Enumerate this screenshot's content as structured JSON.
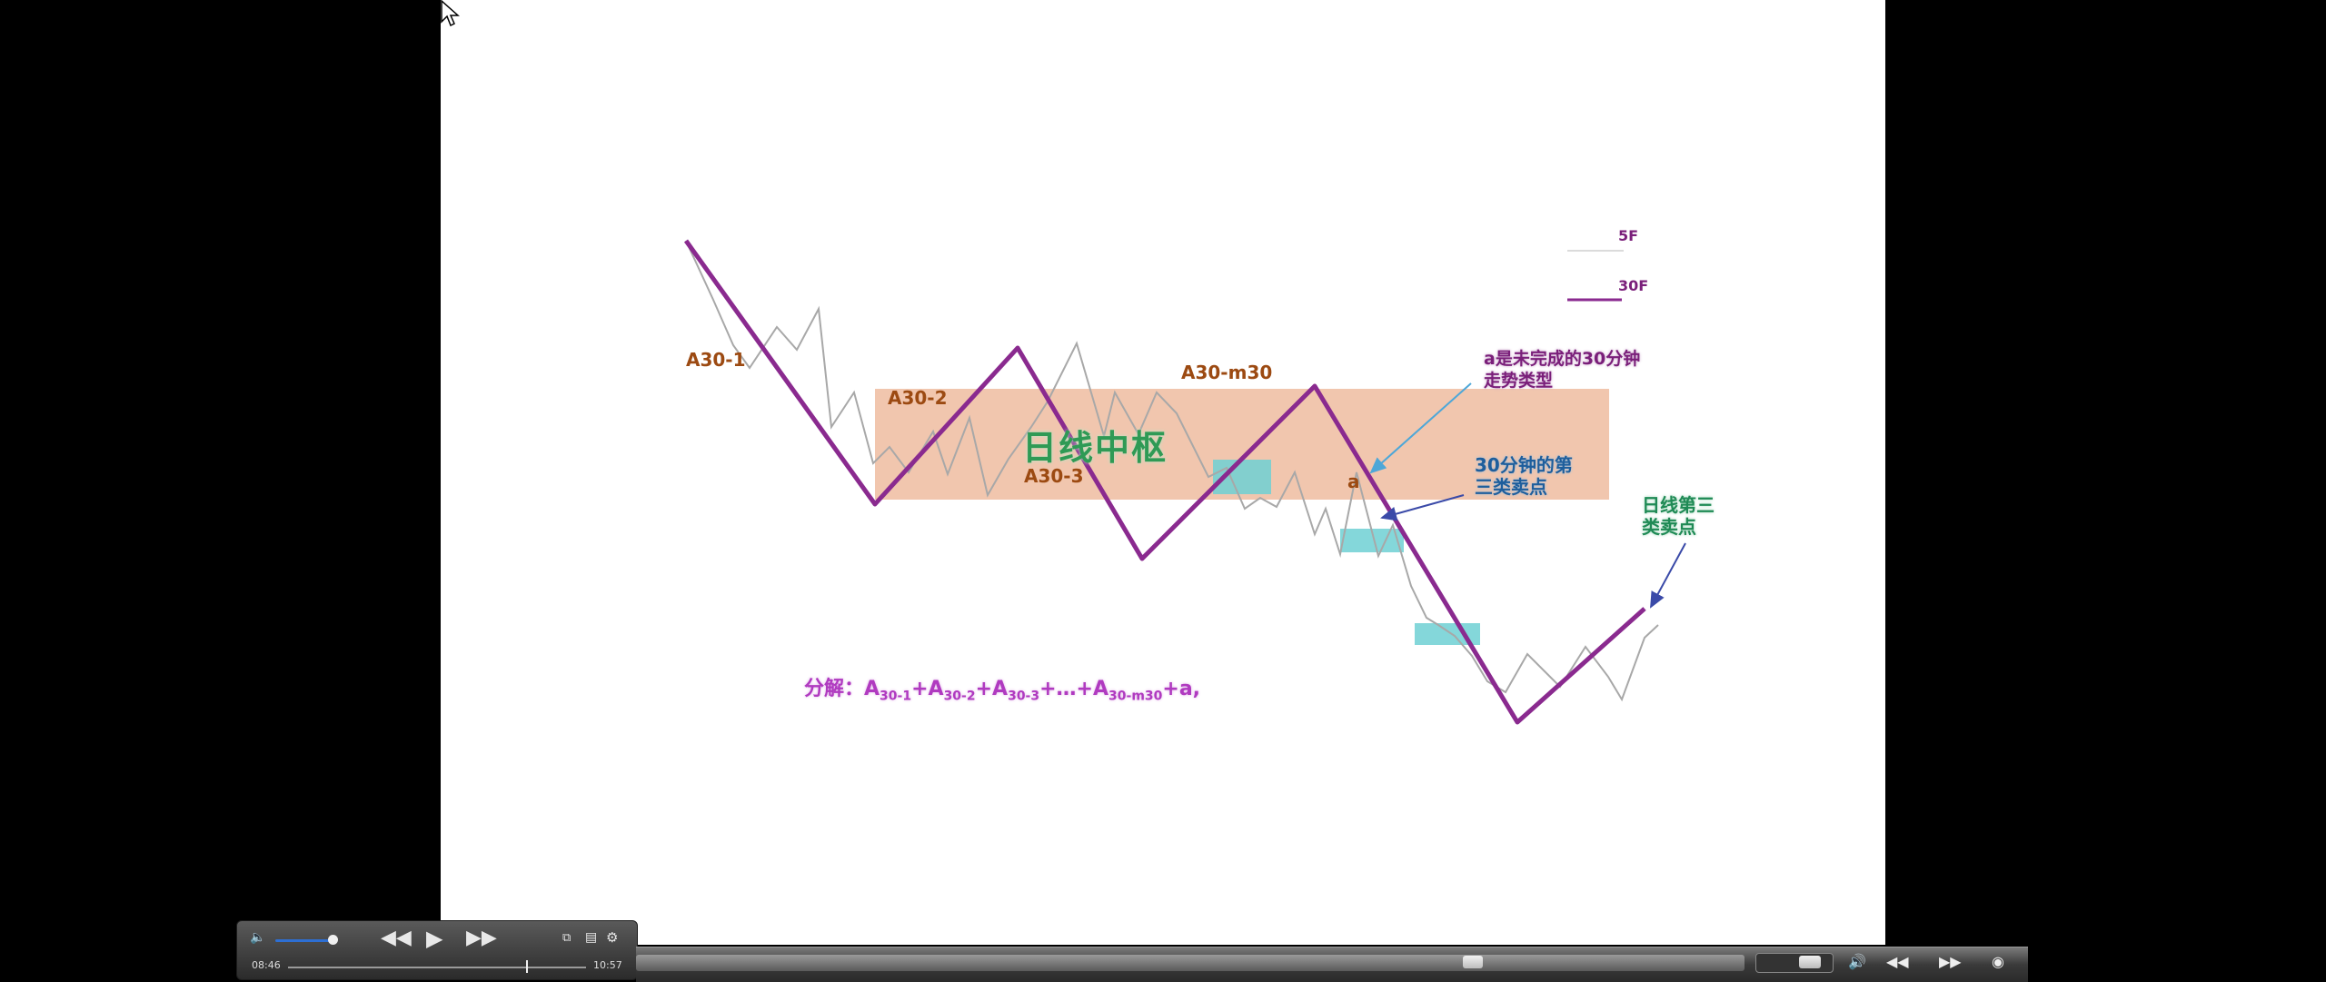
{
  "slide": {
    "labels": {
      "a30_1": "A30-1",
      "a30_2": "A30-2",
      "a30_3": "A30-3",
      "a30_m30": "A30-m30",
      "a": "a",
      "center_title": "日线中枢",
      "legend_5f": "5F",
      "legend_30f": "30F",
      "note_a_line1": "a是未完成的30分钟",
      "note_a_line2": "走势类型",
      "note_30_line1": "30分钟的第",
      "note_30_line2": "三类卖点",
      "note_daily_line1": "日线第三",
      "note_daily_line2": "类卖点"
    },
    "formula": {
      "prefix": "分解：",
      "t1": "A",
      "s1": "30-1",
      "p1": "+A",
      "s2": "30-2",
      "p2": "+A",
      "s3": "30-3",
      "p3": "+…+A",
      "s4": "30-m30",
      "tail": "+a,"
    },
    "colors": {
      "purple_line": "#8a2a8f",
      "grey_line": "#a8a8a8",
      "center_box": "#eebca0",
      "teal_box": "#6fd0d3",
      "arrow_blue": "#4da7d8",
      "arrow_navy": "#3a4aa8"
    }
  },
  "controller": {
    "vol_icon": "🔈",
    "rew_icon": "◀◀",
    "play_icon": "▶",
    "ffw_icon": "▶▶",
    "pip_icon": "⧉",
    "menu_icon": "▤",
    "gear_icon": "⚙",
    "time_elapsed": "08:46",
    "time_total": "10:57",
    "progress": 0.8
  },
  "bottom_bar": {
    "vol_icon": "🔊",
    "rew_icon": "◀◀",
    "ffw_icon": "▶▶",
    "opt_icon": "◉"
  }
}
